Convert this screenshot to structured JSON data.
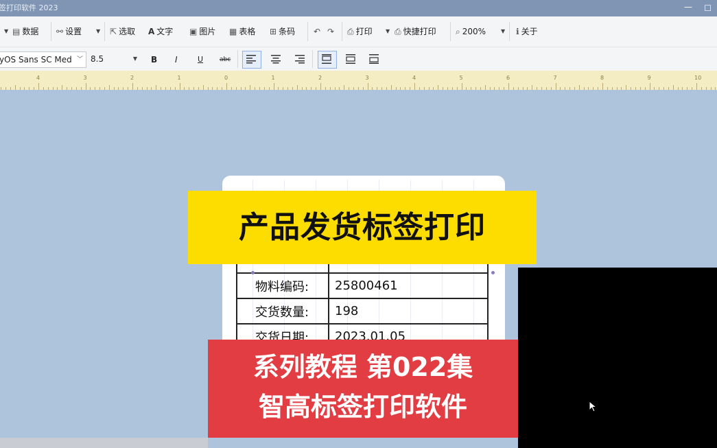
{
  "window": {
    "title": "签打印软件 2023"
  },
  "toolbar": {
    "items": [
      {
        "label": "数据",
        "icon": "database-icon"
      },
      {
        "label": "设置",
        "icon": "link-icon"
      },
      {
        "label": "选取",
        "icon": "pointer-icon"
      },
      {
        "label": "文字",
        "icon": "text-icon"
      },
      {
        "label": "图片",
        "icon": "image-icon"
      },
      {
        "label": "表格",
        "icon": "table-icon"
      },
      {
        "label": "条码",
        "icon": "barcode-icon"
      },
      {
        "label": "打印",
        "icon": "printer-icon"
      },
      {
        "label": "快捷打印",
        "icon": "quick-print-icon"
      },
      {
        "label": "200%",
        "icon": "zoom-icon"
      },
      {
        "label": "关于",
        "icon": "info-icon"
      }
    ]
  },
  "format": {
    "font_name": "yOS Sans SC Med",
    "font_size": "8.5",
    "bold": "B",
    "italic": "I",
    "underline": "U",
    "strike": "abc"
  },
  "ruler": {
    "labels": [
      "4",
      "3",
      "2",
      "1",
      "0",
      "1",
      "2",
      "3",
      "4",
      "5",
      "6",
      "7",
      "8",
      "9",
      "10"
    ]
  },
  "label_table": {
    "rows": [
      {
        "key": "物料编码:",
        "value": "25800461"
      },
      {
        "key": "交货数量:",
        "value": "198"
      },
      {
        "key": "交货日期:",
        "value": "2023.01.05"
      }
    ]
  },
  "overlay": {
    "banner_title": "产品发货标签打印",
    "series_line1": "系列教程 第022集",
    "series_line2": "智高标签打印软件"
  },
  "colors": {
    "banner_yellow": "#fddc00",
    "banner_red": "#e23d43",
    "canvas_bg": "#aec4dd",
    "ruler": "#f4ecc2"
  }
}
